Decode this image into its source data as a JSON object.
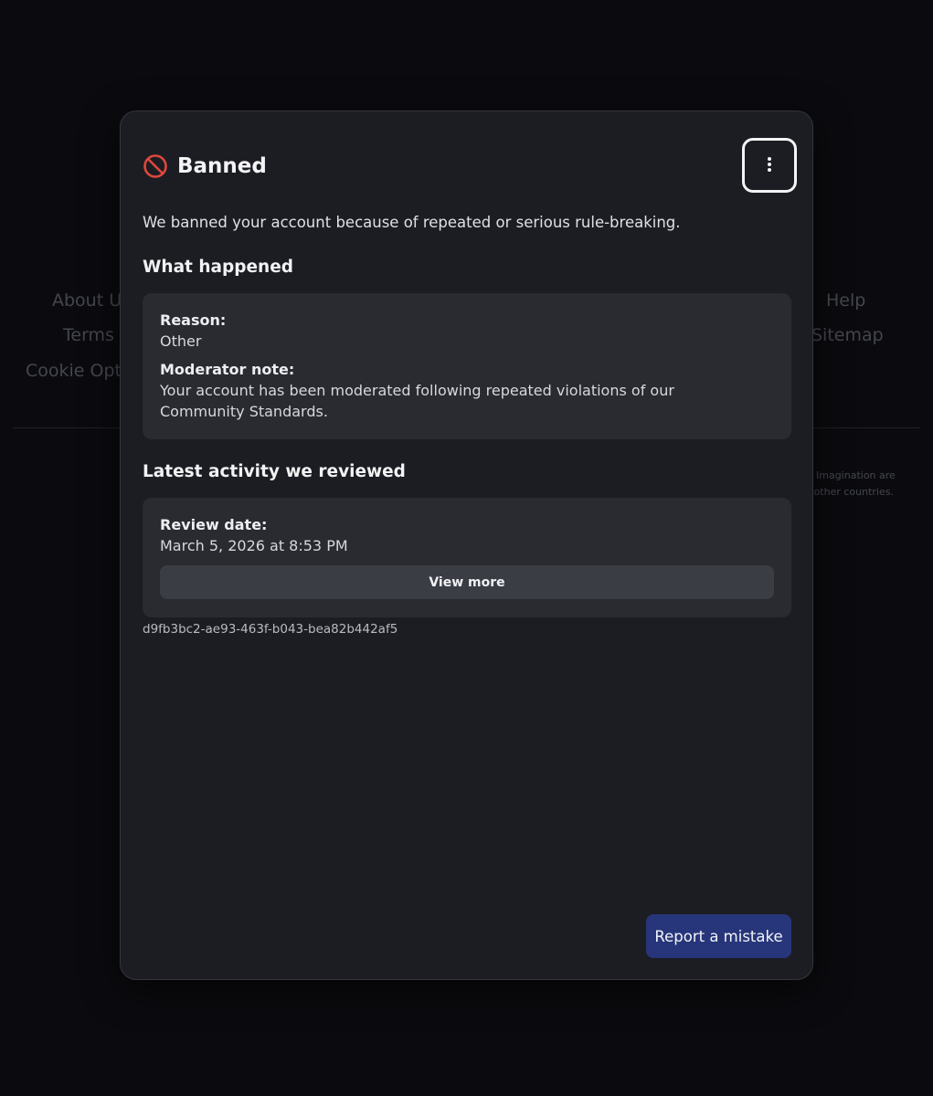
{
  "background": {
    "links_left": [
      "About U",
      "Terms",
      "Cookie Opti"
    ],
    "links_right": [
      "Help",
      "Sitemap"
    ],
    "legal_fragments": [
      "Imagination are",
      "l other countries."
    ]
  },
  "modal": {
    "icon": "ban-icon",
    "title": "Banned",
    "menu_icon": "vertical-ellipsis-icon",
    "subtitle": "We banned your account because of repeated or serious rule-breaking.",
    "what_happened": {
      "heading": "What happened",
      "reason_label": "Reason:",
      "reason_value": "Other",
      "note_label": "Moderator note:",
      "note_value": "Your account has been moderated following repeated violations of our Community Standards."
    },
    "latest_activity": {
      "heading": "Latest activity we reviewed",
      "review_date_label": "Review date:",
      "review_date_value": "March 5, 2026 at 8:53 PM",
      "view_more_label": "View more"
    },
    "reference_id": "d9fb3bc2-ae93-463f-b043-bea82b442af5",
    "report_button_label": "Report a mistake"
  },
  "colors": {
    "ban_icon": "#e0473c",
    "report_button": "#27367a",
    "modal_bg": "#1c1d22",
    "card_bg": "#2a2b31"
  }
}
